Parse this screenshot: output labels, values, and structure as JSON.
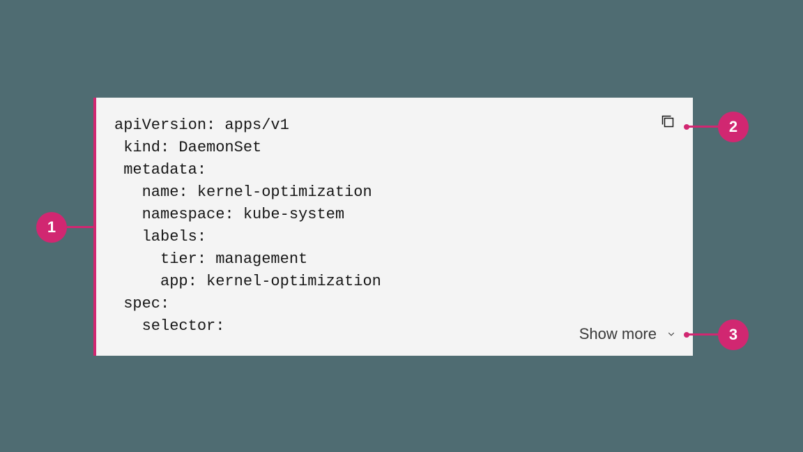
{
  "code_snippet": {
    "lines": [
      "apiVersion: apps/v1",
      " kind: DaemonSet",
      " metadata:",
      "   name: kernel-optimization",
      "   namespace: kube-system",
      "   labels:",
      "     tier: management",
      "     app: kernel-optimization",
      " spec:",
      "   selector:"
    ],
    "copy_icon": "copy-icon",
    "show_more_label": "Show more"
  },
  "annotations": {
    "a1": "1",
    "a2": "2",
    "a3": "3"
  },
  "colors": {
    "background": "#4f6c72",
    "snippet_bg": "#f4f4f4",
    "accent": "#d12771",
    "text": "#161616"
  }
}
